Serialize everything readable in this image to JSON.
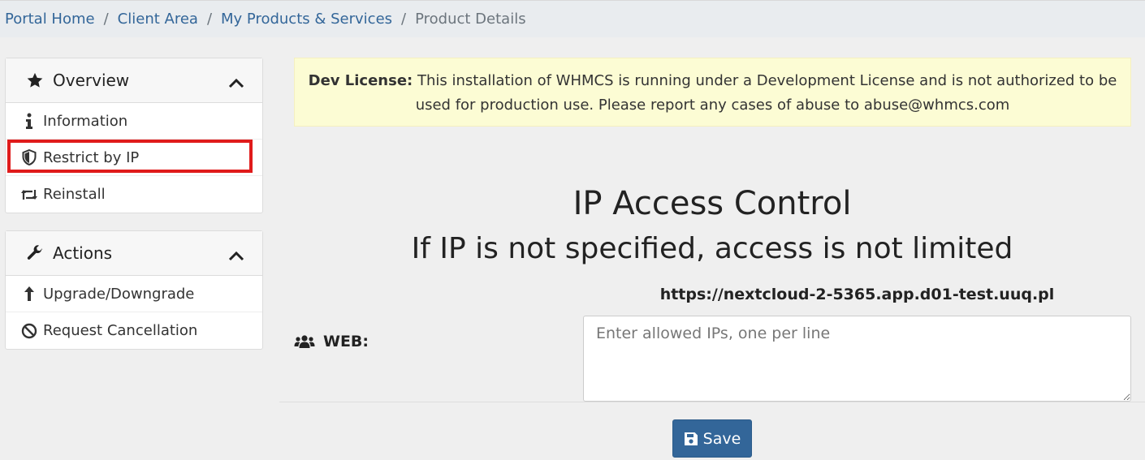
{
  "breadcrumb": {
    "items": [
      "Portal Home",
      "Client Area",
      "My Products & Services"
    ],
    "separator": "/",
    "active": "Product Details"
  },
  "sidebar": {
    "overview": {
      "title": "Overview",
      "icon": "star-icon",
      "items": [
        {
          "label": "Information",
          "icon": "info-icon"
        },
        {
          "label": "Restrict by IP",
          "icon": "shield-icon"
        },
        {
          "label": "Reinstall",
          "icon": "retweet-icon"
        }
      ]
    },
    "actions": {
      "title": "Actions",
      "icon": "wrench-icon",
      "items": [
        {
          "label": "Upgrade/Downgrade",
          "icon": "arrow-up-icon"
        },
        {
          "label": "Request Cancellation",
          "icon": "ban-icon"
        }
      ]
    }
  },
  "alert": {
    "bold": "Dev License:",
    "text": " This installation of WHMCS is running under a Development License and is not authorized to be used for production use. Please report any cases of abuse to abuse@whmcs.com"
  },
  "main": {
    "title": "IP Access Control",
    "subtitle": "If IP is not specified, access is not limited",
    "url": "https://nextcloud-2-5365.app.d01-test.uuq.pl",
    "web_label": "WEB:",
    "textarea_placeholder": "Enter allowed IPs, one per line",
    "save_label": "Save"
  },
  "colors": {
    "link": "#336699",
    "button": "#336699",
    "alert_bg": "#fcfcd4",
    "highlight": "#e01b1b"
  }
}
